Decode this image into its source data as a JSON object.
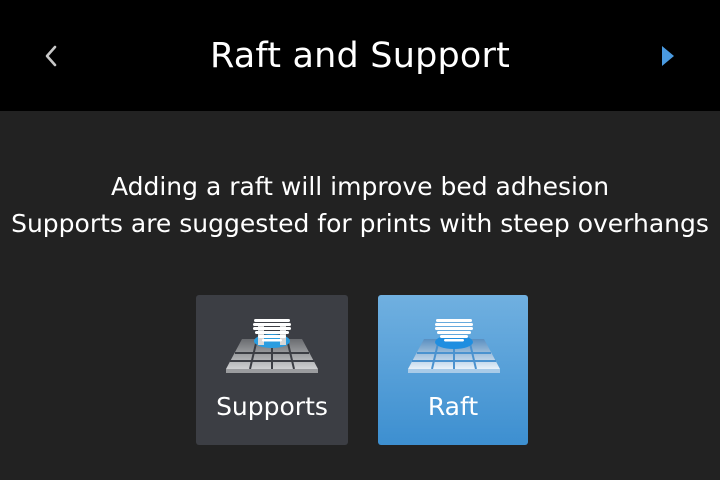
{
  "header": {
    "title": "Raft and Support",
    "back_icon": "chevron-left-icon",
    "next_icon": "triangle-right-icon",
    "next_color": "#4a9ae0"
  },
  "message": {
    "line1": "Adding a raft will improve bed adhesion",
    "line2": "Supports are suggested for prints with steep overhangs"
  },
  "options": [
    {
      "id": "supports",
      "label": "Supports",
      "selected": false,
      "icon": "supports-print-icon"
    },
    {
      "id": "raft",
      "label": "Raft",
      "selected": true,
      "icon": "raft-print-icon"
    }
  ],
  "colors": {
    "accent": "#3d8fd0",
    "accent_light": "#70b0e0",
    "tile_unselected": "#3c3e44",
    "background": "#222222",
    "header": "#000000"
  }
}
